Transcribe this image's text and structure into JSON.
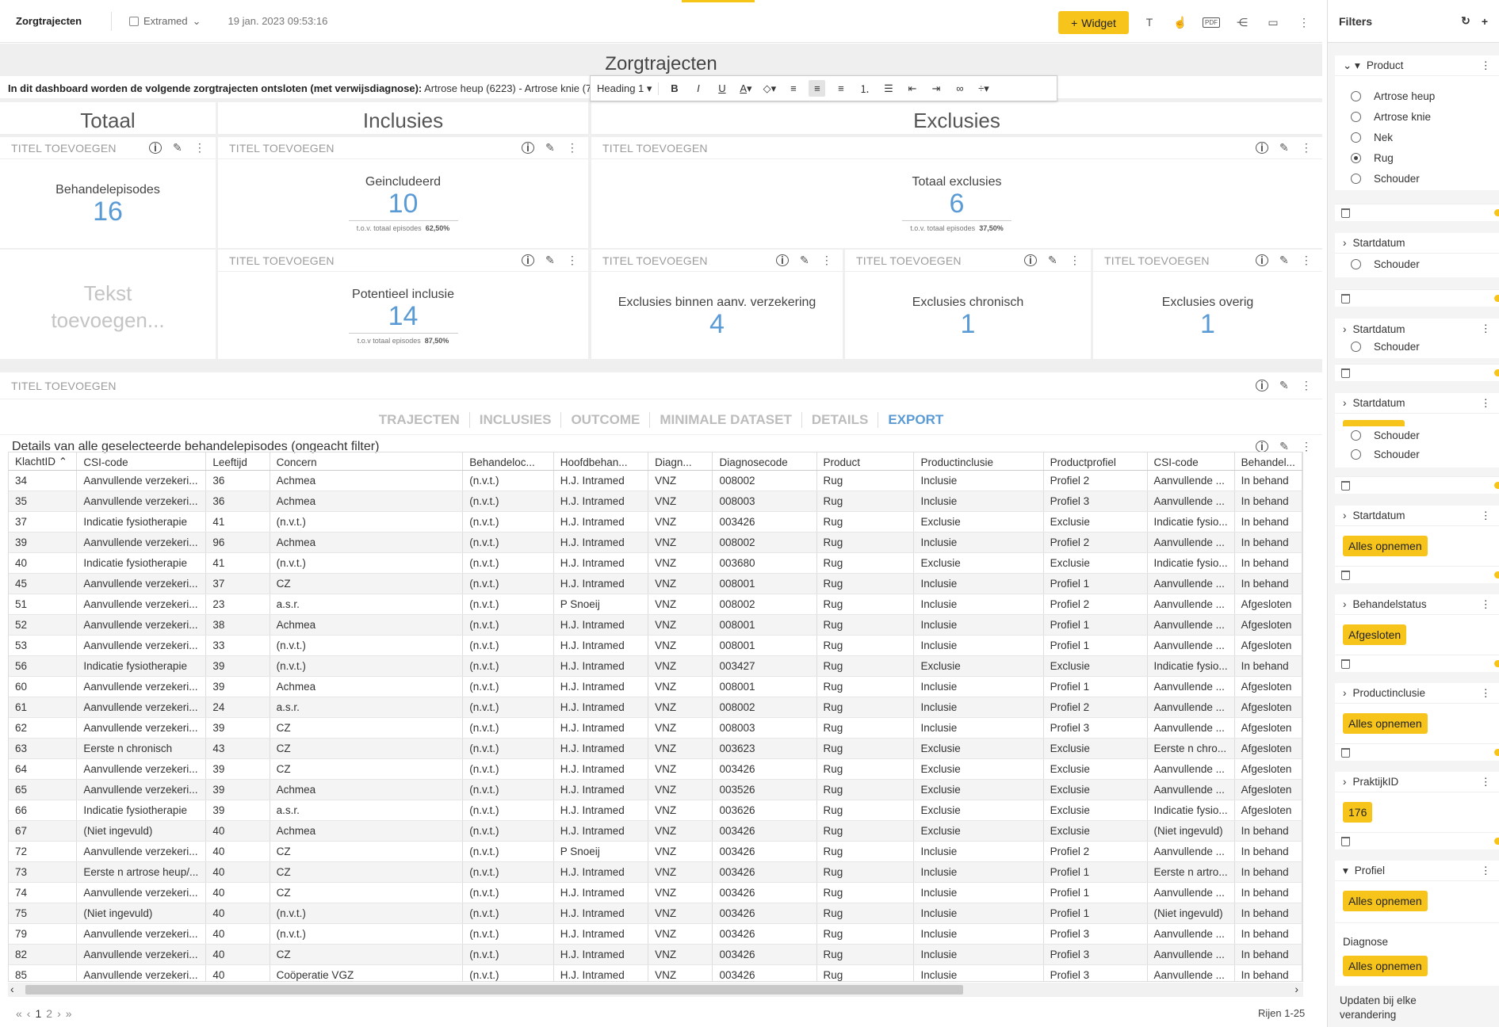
{
  "topbar": {
    "app_title": "Zorgtrajecten",
    "source": "Extramed",
    "timestamp": "19 jan. 2023 09:53:16",
    "widget_button": "Widget",
    "icons": [
      "text-icon",
      "touch-icon",
      "pdf-icon",
      "share-icon",
      "monitor-icon",
      "more-icon"
    ],
    "pdf_label": "PDF"
  },
  "dashboard": {
    "title": "Zorgtrajecten",
    "intro_bold": "In dit dashboard worden de volgende zorgtrajecten ontsloten (met verwijsdiagnose):",
    "intro_text": "Artrose heup (6223) - Artrose knie (7"
  },
  "editor": {
    "style": "Heading 1"
  },
  "sections": {
    "totaal": "Totaal",
    "inclusies": "Inclusies",
    "exclusies": "Exclusies"
  },
  "tile_title": "TITEL TOEVOEGEN",
  "kpis": {
    "behandelepisodes": {
      "label": "Behandelepisodes",
      "value": "16"
    },
    "geincludeerd": {
      "label": "Geincludeerd",
      "value": "10",
      "sub_label": "t.o.v. totaal episodes",
      "sub_value": "62,50%"
    },
    "totaal_exclusies": {
      "label": "Totaal exclusies",
      "value": "6",
      "sub_label": "t.o.v. totaal episodes",
      "sub_value": "37,50%"
    },
    "potentieel_inclusie": {
      "label": "Potentieel inclusie",
      "value": "14",
      "sub_label": "t.o.v totaal episodes",
      "sub_value": "87,50%"
    },
    "exclusies_verzekering": {
      "label": "Exclusies binnen aanv. verzekering",
      "value": "4"
    },
    "exclusies_chronisch": {
      "label": "Exclusies chronisch",
      "value": "1"
    },
    "exclusies_overig": {
      "label": "Exclusies overig",
      "value": "1"
    }
  },
  "tekst_placeholder": {
    "line1": "Tekst",
    "line2": "toevoegen..."
  },
  "detail": {
    "title": "TITEL TOEVOEGEN",
    "tabs": [
      "TRAJECTEN",
      "INCLUSIES",
      "OUTCOME",
      "MINIMALE DATASET",
      "DETAILS",
      "EXPORT"
    ],
    "active_tab": "EXPORT",
    "subtitle": "Details van alle geselecteerde behandelepisodes (ongeacht filter)",
    "columns": [
      "KlachtID",
      "CSI-code",
      "Leeftijd",
      "Concern",
      "Behandeloc...",
      "Hoofdbehan...",
      "Diagn...",
      "Diagnosecode",
      "Product",
      "Productinclusie",
      "Productprofiel",
      "CSI-code",
      "Behandel..."
    ],
    "rows": [
      [
        "34",
        "Aanvullende verzekeri...",
        "36",
        "Achmea",
        "(n.v.t.)",
        "H.J. Intramed",
        "VNZ",
        "008002",
        "Rug",
        "Inclusie",
        "Profiel 2",
        "Aanvullende ...",
        "In behand"
      ],
      [
        "35",
        "Aanvullende verzekeri...",
        "36",
        "Achmea",
        "(n.v.t.)",
        "H.J. Intramed",
        "VNZ",
        "008003",
        "Rug",
        "Inclusie",
        "Profiel 3",
        "Aanvullende ...",
        "In behand"
      ],
      [
        "37",
        "Indicatie fysiotherapie",
        "41",
        "(n.v.t.)",
        "(n.v.t.)",
        "H.J. Intramed",
        "VNZ",
        "003426",
        "Rug",
        "Exclusie",
        "Exclusie",
        "Indicatie fysio...",
        "In behand"
      ],
      [
        "39",
        "Aanvullende verzekeri...",
        "96",
        "Achmea",
        "(n.v.t.)",
        "H.J. Intramed",
        "VNZ",
        "008002",
        "Rug",
        "Inclusie",
        "Profiel 2",
        "Aanvullende ...",
        "In behand"
      ],
      [
        "40",
        "Indicatie fysiotherapie",
        "41",
        "(n.v.t.)",
        "(n.v.t.)",
        "H.J. Intramed",
        "VNZ",
        "003680",
        "Rug",
        "Exclusie",
        "Exclusie",
        "Indicatie fysio...",
        "In behand"
      ],
      [
        "45",
        "Aanvullende verzekeri...",
        "37",
        "CZ",
        "(n.v.t.)",
        "H.J. Intramed",
        "VNZ",
        "008001",
        "Rug",
        "Inclusie",
        "Profiel 1",
        "Aanvullende ...",
        "In behand"
      ],
      [
        "51",
        "Aanvullende verzekeri...",
        "23",
        "a.s.r.",
        "(n.v.t.)",
        "P Snoeij",
        "VNZ",
        "008002",
        "Rug",
        "Inclusie",
        "Profiel 2",
        "Aanvullende ...",
        "Afgesloten"
      ],
      [
        "52",
        "Aanvullende verzekeri...",
        "38",
        "Achmea",
        "(n.v.t.)",
        "H.J. Intramed",
        "VNZ",
        "008001",
        "Rug",
        "Inclusie",
        "Profiel 1",
        "Aanvullende ...",
        "Afgesloten"
      ],
      [
        "53",
        "Aanvullende verzekeri...",
        "33",
        "(n.v.t.)",
        "(n.v.t.)",
        "H.J. Intramed",
        "VNZ",
        "008001",
        "Rug",
        "Inclusie",
        "Profiel 1",
        "Aanvullende ...",
        "Afgesloten"
      ],
      [
        "56",
        "Indicatie fysiotherapie",
        "39",
        "(n.v.t.)",
        "(n.v.t.)",
        "H.J. Intramed",
        "VNZ",
        "003427",
        "Rug",
        "Exclusie",
        "Exclusie",
        "Indicatie fysio...",
        "In behand"
      ],
      [
        "60",
        "Aanvullende verzekeri...",
        "39",
        "Achmea",
        "(n.v.t.)",
        "H.J. Intramed",
        "VNZ",
        "008001",
        "Rug",
        "Inclusie",
        "Profiel 1",
        "Aanvullende ...",
        "Afgesloten"
      ],
      [
        "61",
        "Aanvullende verzekeri...",
        "24",
        "a.s.r.",
        "(n.v.t.)",
        "H.J. Intramed",
        "VNZ",
        "008002",
        "Rug",
        "Inclusie",
        "Profiel 2",
        "Aanvullende ...",
        "Afgesloten"
      ],
      [
        "62",
        "Aanvullende verzekeri...",
        "39",
        "CZ",
        "(n.v.t.)",
        "H.J. Intramed",
        "VNZ",
        "008003",
        "Rug",
        "Inclusie",
        "Profiel 3",
        "Aanvullende ...",
        "Afgesloten"
      ],
      [
        "63",
        "Eerste n chronisch",
        "43",
        "CZ",
        "(n.v.t.)",
        "H.J. Intramed",
        "VNZ",
        "003623",
        "Rug",
        "Exclusie",
        "Exclusie",
        "Eerste n chro...",
        "Afgesloten"
      ],
      [
        "64",
        "Aanvullende verzekeri...",
        "39",
        "CZ",
        "(n.v.t.)",
        "H.J. Intramed",
        "VNZ",
        "003426",
        "Rug",
        "Exclusie",
        "Exclusie",
        "Aanvullende ...",
        "Afgesloten"
      ],
      [
        "65",
        "Aanvullende verzekeri...",
        "39",
        "Achmea",
        "(n.v.t.)",
        "H.J. Intramed",
        "VNZ",
        "003526",
        "Rug",
        "Exclusie",
        "Exclusie",
        "Aanvullende ...",
        "Afgesloten"
      ],
      [
        "66",
        "Indicatie fysiotherapie",
        "39",
        "a.s.r.",
        "(n.v.t.)",
        "H.J. Intramed",
        "VNZ",
        "003626",
        "Rug",
        "Exclusie",
        "Exclusie",
        "Indicatie fysio...",
        "Afgesloten"
      ],
      [
        "67",
        "(Niet ingevuld)",
        "40",
        "Achmea",
        "(n.v.t.)",
        "H.J. Intramed",
        "VNZ",
        "003426",
        "Rug",
        "Exclusie",
        "Exclusie",
        "(Niet ingevuld)",
        "In behand"
      ],
      [
        "72",
        "Aanvullende verzekeri...",
        "40",
        "CZ",
        "(n.v.t.)",
        "P Snoeij",
        "VNZ",
        "003426",
        "Rug",
        "Inclusie",
        "Profiel 2",
        "Aanvullende ...",
        "In behand"
      ],
      [
        "73",
        "Eerste n artrose heup/...",
        "40",
        "CZ",
        "(n.v.t.)",
        "H.J. Intramed",
        "VNZ",
        "003426",
        "Rug",
        "Inclusie",
        "Profiel 1",
        "Eerste n artro...",
        "In behand"
      ],
      [
        "74",
        "Aanvullende verzekeri...",
        "40",
        "CZ",
        "(n.v.t.)",
        "H.J. Intramed",
        "VNZ",
        "003426",
        "Rug",
        "Inclusie",
        "Profiel 1",
        "Aanvullende ...",
        "In behand"
      ],
      [
        "75",
        "(Niet ingevuld)",
        "40",
        "(n.v.t.)",
        "(n.v.t.)",
        "H.J. Intramed",
        "VNZ",
        "003426",
        "Rug",
        "Inclusie",
        "Profiel 1",
        "(Niet ingevuld)",
        "In behand"
      ],
      [
        "79",
        "Aanvullende verzekeri...",
        "40",
        "(n.v.t.)",
        "(n.v.t.)",
        "H.J. Intramed",
        "VNZ",
        "003426",
        "Rug",
        "Inclusie",
        "Profiel 3",
        "Aanvullende ...",
        "In behand"
      ],
      [
        "82",
        "Aanvullende verzekeri...",
        "40",
        "CZ",
        "(n.v.t.)",
        "H.J. Intramed",
        "VNZ",
        "003426",
        "Rug",
        "Inclusie",
        "Profiel 3",
        "Aanvullende ...",
        "In behand"
      ],
      [
        "85",
        "Aanvullende verzekeri...",
        "40",
        "Coöperatie VGZ",
        "(n.v.t.)",
        "H.J. Intramed",
        "VNZ",
        "003426",
        "Rug",
        "Inclusie",
        "Profiel 3",
        "Aanvullende ...",
        "In behand"
      ]
    ],
    "pager": {
      "page1": "1",
      "page2": "2"
    },
    "rows_label": "Rijen 1-25"
  },
  "filters": {
    "title": "Filters",
    "product": {
      "title": "Product",
      "options": [
        "Artrose heup",
        "Artrose knie",
        "Nek",
        "Rug",
        "Schouder"
      ],
      "selected": "Rug"
    },
    "startdatum": "Startdatum",
    "schouder": "Schouder",
    "alles_opnemen": "Alles opnemen",
    "behandelstatus": {
      "title": "Behandelstatus",
      "value": "Afgesloten"
    },
    "productinclusie": {
      "title": "Productinclusie",
      "value": "Alles opnemen"
    },
    "praktijkid": {
      "title": "PraktijkID",
      "value": "176"
    },
    "profiel": {
      "title": "Profiel",
      "value": "Alles opnemen"
    },
    "diagnose": {
      "title": "Diagnose",
      "value": "Alles opnemen"
    },
    "update_line1": "Updaten bij elke",
    "update_line2": "verandering"
  },
  "colors": {
    "accent": "#f7c41b",
    "kpi_blue": "#5b9bd5"
  }
}
